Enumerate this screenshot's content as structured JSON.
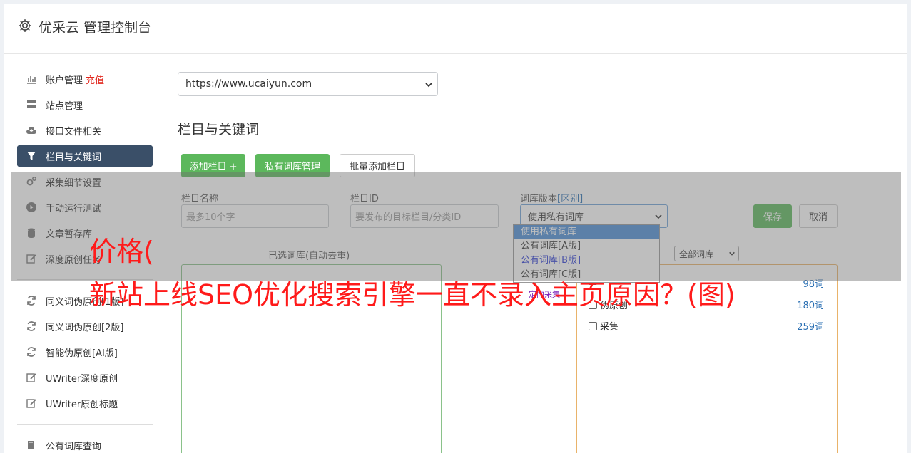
{
  "header": {
    "title": "优采云 管理控制台",
    "icon": "gear-icon"
  },
  "sidebar": {
    "items": [
      {
        "label": "账户管理",
        "extra": "充值",
        "icon": "bar-chart-icon"
      },
      {
        "label": "站点管理",
        "icon": "server-icon"
      },
      {
        "label": "接口文件相关",
        "icon": "cloud-upload-icon"
      },
      {
        "label": "栏目与关键词",
        "icon": "filter-icon",
        "active": true
      },
      {
        "label": "采集细节设置",
        "icon": "cogs-icon"
      },
      {
        "label": "手动运行测试",
        "icon": "play-circle-icon"
      },
      {
        "label": "文章暂存库",
        "icon": "database-icon"
      },
      {
        "label": "深度原创任务",
        "icon": "edit-icon"
      }
    ],
    "items2": [
      {
        "label": "同义词伪原创[1版]",
        "icon": "refresh-icon"
      },
      {
        "label": "同义词伪原创[2版]",
        "icon": "refresh-icon"
      },
      {
        "label": "智能伪原创[AI版]",
        "icon": "refresh-icon"
      },
      {
        "label": "UWriter深度原创",
        "icon": "edit-icon"
      },
      {
        "label": "UWriter原创标题",
        "icon": "edit-icon"
      }
    ],
    "items3": [
      {
        "label": "公有词库查询",
        "icon": "book-icon"
      }
    ]
  },
  "main": {
    "site_select": "https://www.ucaiyun.com",
    "section_title": "栏目与关键词",
    "buttons": {
      "add_column": "添加栏目 +",
      "private_lib": "私有词库管理",
      "batch_add": "批量添加栏目"
    },
    "form": {
      "name_label": "栏目名称",
      "name_placeholder": "最多10个字",
      "id_label": "栏目ID",
      "id_placeholder": "要发布的目标栏目/分类ID",
      "version_label": "词库版本",
      "version_link": "[区别]",
      "version_value": "使用私有词库",
      "save": "保存",
      "cancel": "取消"
    },
    "version_options": [
      "使用私有词库",
      "公有词库[A版]",
      "公有词库[B版]",
      "公有词库[C版]"
    ],
    "selected_lib_title": "已选词库(自动去重)",
    "lib_filter": "全部词库",
    "libraries": [
      {
        "name": "",
        "count": "98词"
      },
      {
        "name": "伪原创",
        "count": "180词"
      },
      {
        "name": "采集",
        "count": "259词"
      }
    ],
    "tiny_link": "定向采集"
  },
  "watermark": {
    "line1": "价格(",
    "line2": "新站上线SEO优化搜索引擎一直不录入主页原因？(图)"
  },
  "colors": {
    "accent_green": "#5cb85c",
    "active_nav": "#3a4f68",
    "link": "#2a6fb3",
    "recharge": "#e1261c",
    "watermark": "#ff1a1a"
  }
}
